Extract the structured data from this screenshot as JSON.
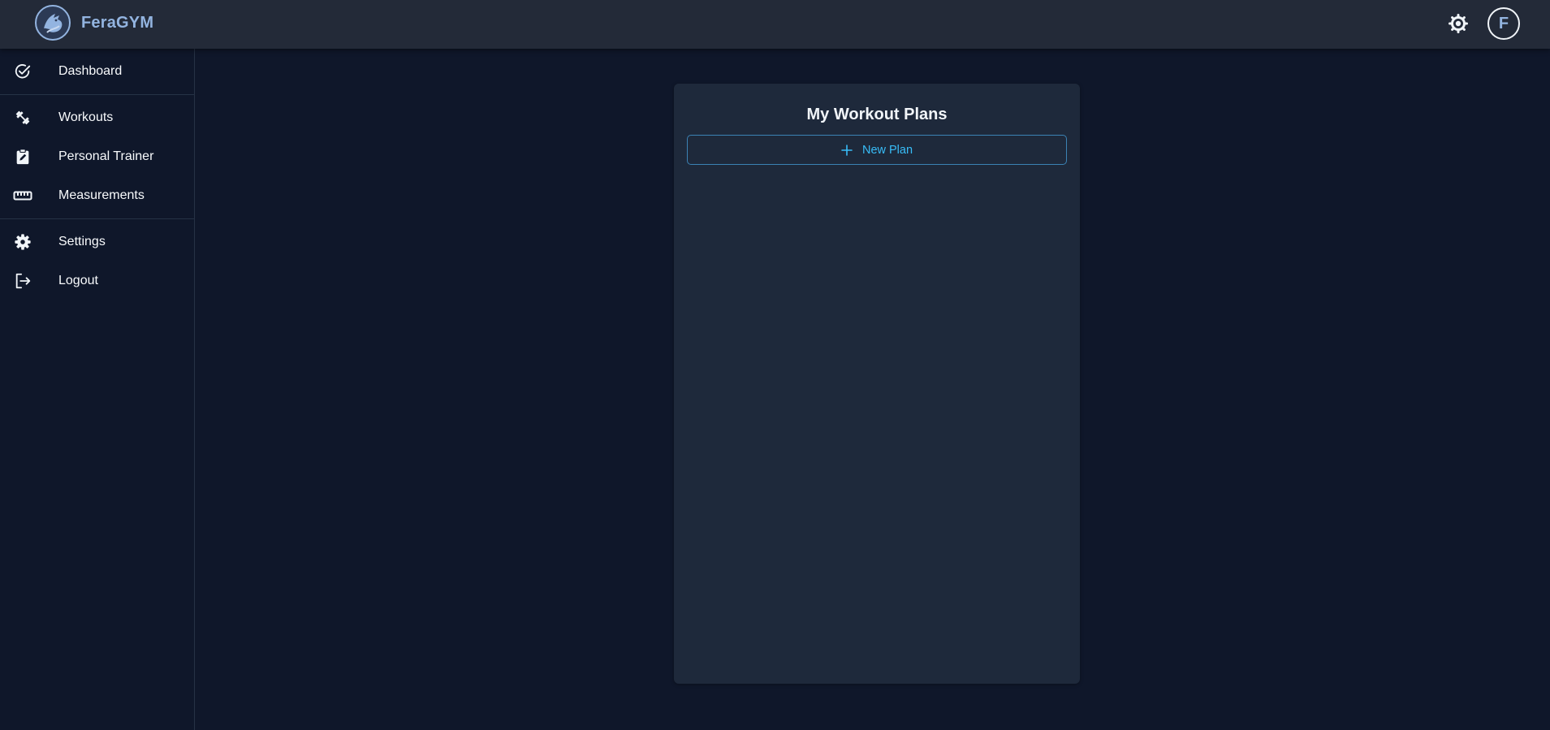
{
  "brand": {
    "name": "FeraGYM",
    "logo_icon": "wolf-logo-icon",
    "color": "#93b4e0"
  },
  "header": {
    "theme_icon": "sun-icon",
    "avatar_initial": "F"
  },
  "sidebar": {
    "groups": [
      [
        {
          "label": "Dashboard",
          "icon": "check-circle-icon"
        }
      ],
      [
        {
          "label": "Workouts",
          "icon": "dumbbell-icon"
        },
        {
          "label": "Personal Trainer",
          "icon": "clipboard-edit-icon"
        },
        {
          "label": "Measurements",
          "icon": "ruler-icon"
        }
      ],
      [
        {
          "label": "Settings",
          "icon": "gear-icon"
        },
        {
          "label": "Logout",
          "icon": "logout-icon"
        }
      ]
    ]
  },
  "main": {
    "card_title": "My Workout Plans",
    "new_plan_label": "New Plan",
    "new_plan_icon": "plus-icon",
    "accent": "#38bdf8"
  },
  "colors": {
    "background": "#0f172a",
    "topbar": "#232a38",
    "card": "#1e293b"
  }
}
